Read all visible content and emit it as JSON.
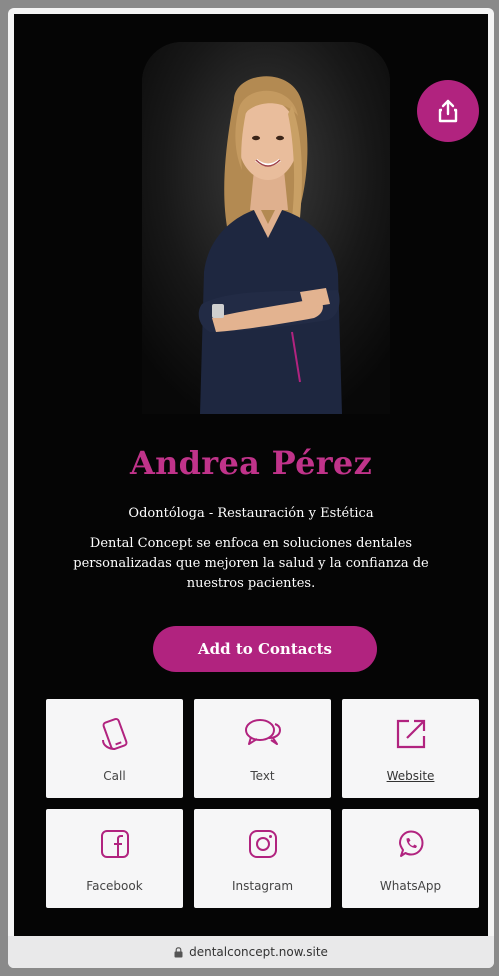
{
  "profile": {
    "name": "Andrea Pérez",
    "subtitle": "Odontóloga - Restauración y Estética",
    "description": "Dental Concept se enfoca en soluciones dentales personalizadas que mejoren la salud y la confianza de nuestros pacientes."
  },
  "actions": {
    "add_to_contacts": "Add to Contacts",
    "share_icon": "share-icon"
  },
  "tiles": [
    {
      "label": "Call",
      "icon": "phone-icon"
    },
    {
      "label": "Text",
      "icon": "chat-icon"
    },
    {
      "label": "Website",
      "icon": "external-link-icon"
    },
    {
      "label": "Facebook",
      "icon": "facebook-icon"
    },
    {
      "label": "Instagram",
      "icon": "instagram-icon"
    },
    {
      "label": "WhatsApp",
      "icon": "whatsapp-icon"
    }
  ],
  "browser": {
    "url": "dentalconcept.now.site"
  },
  "colors": {
    "accent": "#b1237f",
    "name": "#c0338a",
    "background": "#050505",
    "tile": "#f6f6f7"
  }
}
